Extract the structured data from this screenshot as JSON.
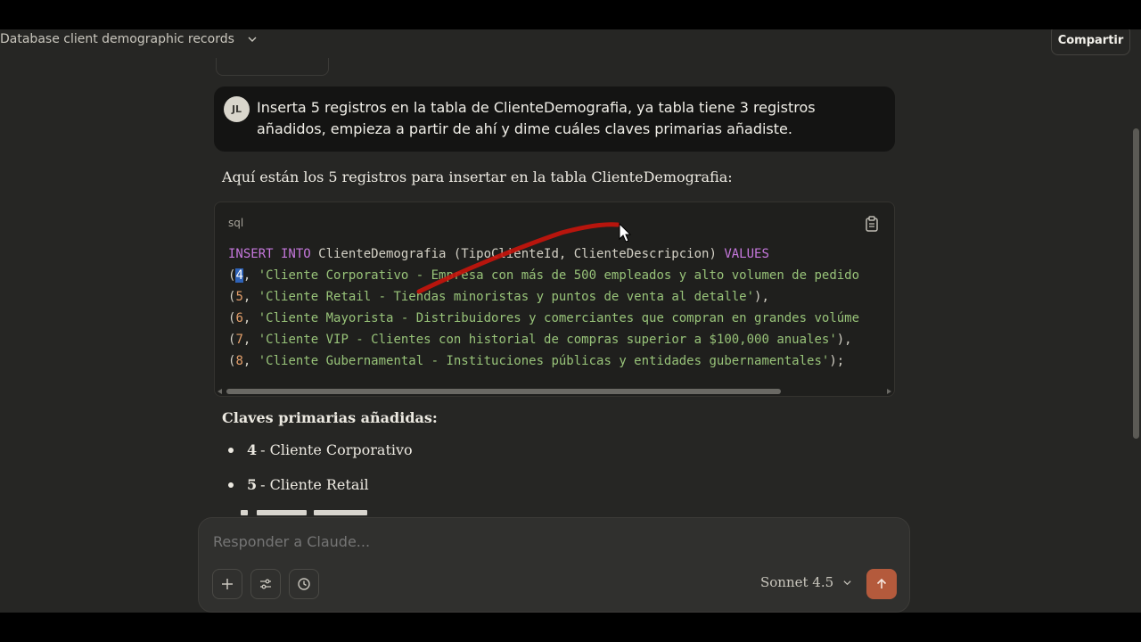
{
  "header": {
    "conversation_title": "Database client demographic records",
    "share_label": "Compartir"
  },
  "user_message": {
    "avatar_initials": "JL",
    "text": "Inserta 5 registros en la tabla de ClienteDemografia, ya tabla tiene 3 registros añadidos, empieza a partir de ahí y dime cuáles claves primarias añadiste."
  },
  "assistant": {
    "intro": "Aquí están los 5 registros para insertar en la tabla ClienteDemografia:",
    "code": {
      "language": "sql",
      "line1": {
        "kw1": "INSERT INTO",
        "table": " ClienteDemografia (TipoClienteId, ClienteDescripcion) ",
        "kw2": "VALUES"
      },
      "rows": [
        {
          "num": "4",
          "str": "'Cliente Corporativo - Empresa con más de 500 empleados y alto volumen de pedido",
          "end": ""
        },
        {
          "num": "5",
          "str": "'Cliente Retail - Tiendas minoristas y puntos de venta al detalle'",
          "end": "),"
        },
        {
          "num": "6",
          "str": "'Cliente Mayorista - Distribuidores y comerciantes que compran en grandes volúme",
          "end": ""
        },
        {
          "num": "7",
          "str": "'Cliente VIP - Clientes con historial de compras superior a $100,000 anuales'",
          "end": "),"
        },
        {
          "num": "8",
          "str": "'Cliente Gubernamental - Instituciones públicas y entidades gubernamentales'",
          "end": ");"
        }
      ]
    },
    "keys_heading": "Claves primarias añadidas:",
    "keys": [
      {
        "num": "4",
        "label": "- Cliente Corporativo"
      },
      {
        "num": "5",
        "label": "- Cliente Retail"
      }
    ]
  },
  "composer": {
    "placeholder": "Responder a Claude...",
    "model": "Sonnet 4.5"
  },
  "colors": {
    "background": "#262624",
    "send_button": "#b45a3c",
    "keyword": "#c678dd",
    "string": "#98c379",
    "number": "#e5a06b",
    "annotation_stroke": "#c8140c"
  },
  "icons": [
    "chevron-down-icon",
    "clipboard-icon",
    "plus-icon",
    "sliders-icon",
    "history-icon",
    "arrow-up-icon",
    "cursor-icon"
  ]
}
